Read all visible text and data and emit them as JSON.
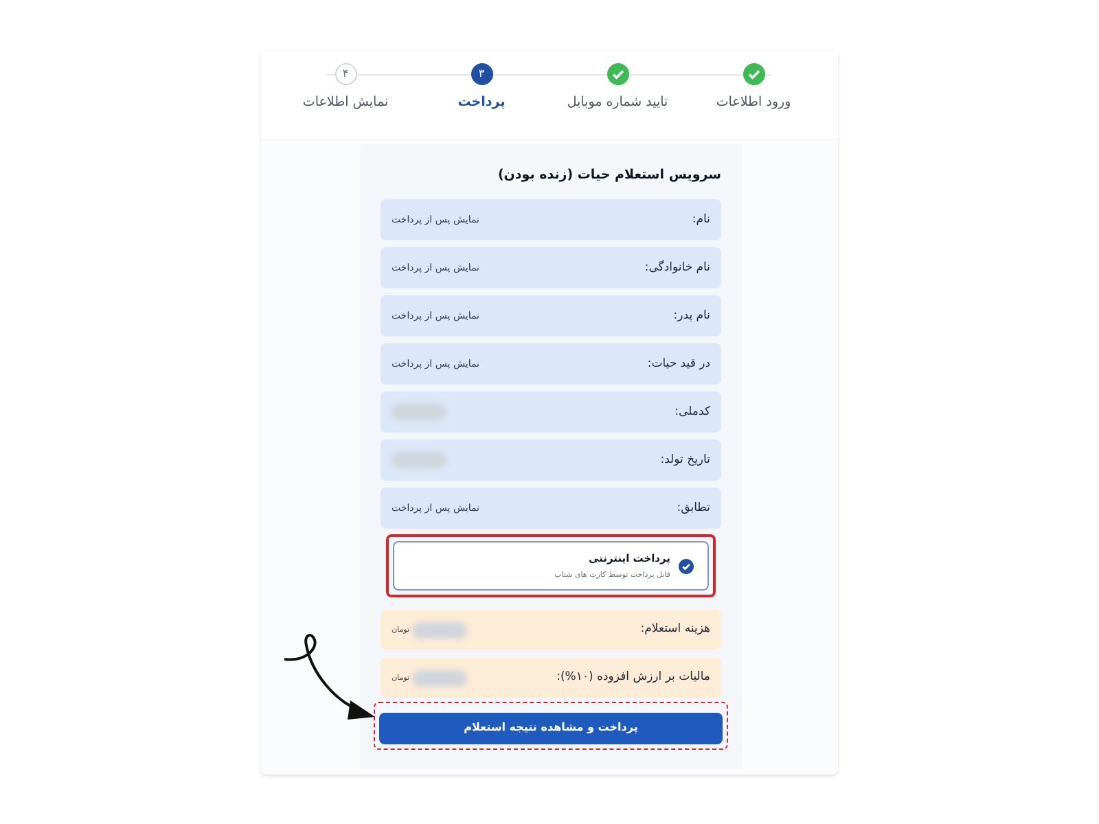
{
  "steps": [
    {
      "label": "ورود اطلاعات",
      "kind": "done"
    },
    {
      "label": "تایید شماره موبایل",
      "kind": "done"
    },
    {
      "label": "پرداخت",
      "kind": "current",
      "number": "۳"
    },
    {
      "label": "نمایش اطلاعات",
      "kind": "pending",
      "number": "۴"
    }
  ],
  "title": "سرویس استعلام حیات (زنده بودن)",
  "fields": [
    {
      "label": "نام:",
      "value": "نمایش پس از پرداخت"
    },
    {
      "label": "نام خانوادگی:",
      "value": "نمایش پس از پرداخت"
    },
    {
      "label": "نام پدر:",
      "value": "نمایش پس از پرداخت"
    },
    {
      "label": "در قید حیات:",
      "value": "نمایش پس از پرداخت"
    },
    {
      "label": "کدملی:",
      "blurred": true
    },
    {
      "label": "تاریخ تولد:",
      "blurred": true
    },
    {
      "label": "تطابق:",
      "value": "نمایش پس از پرداخت"
    }
  ],
  "payment_option": {
    "title": "پرداخت اینترنتی",
    "subtitle": "قابل پرداخت توسط کارت های شتاب",
    "selected": true,
    "highlighted": true
  },
  "costs": [
    {
      "label": "هزینه استعلام:",
      "unit": "تومان",
      "blurred": true
    },
    {
      "label": "مالیات بر ارزش افزوده (۱۰%):",
      "unit": "تومان",
      "blurred": true
    }
  ],
  "submit_button": {
    "label": "پرداخت و مشاهده نتیجه استعلام",
    "highlighted": true
  }
}
